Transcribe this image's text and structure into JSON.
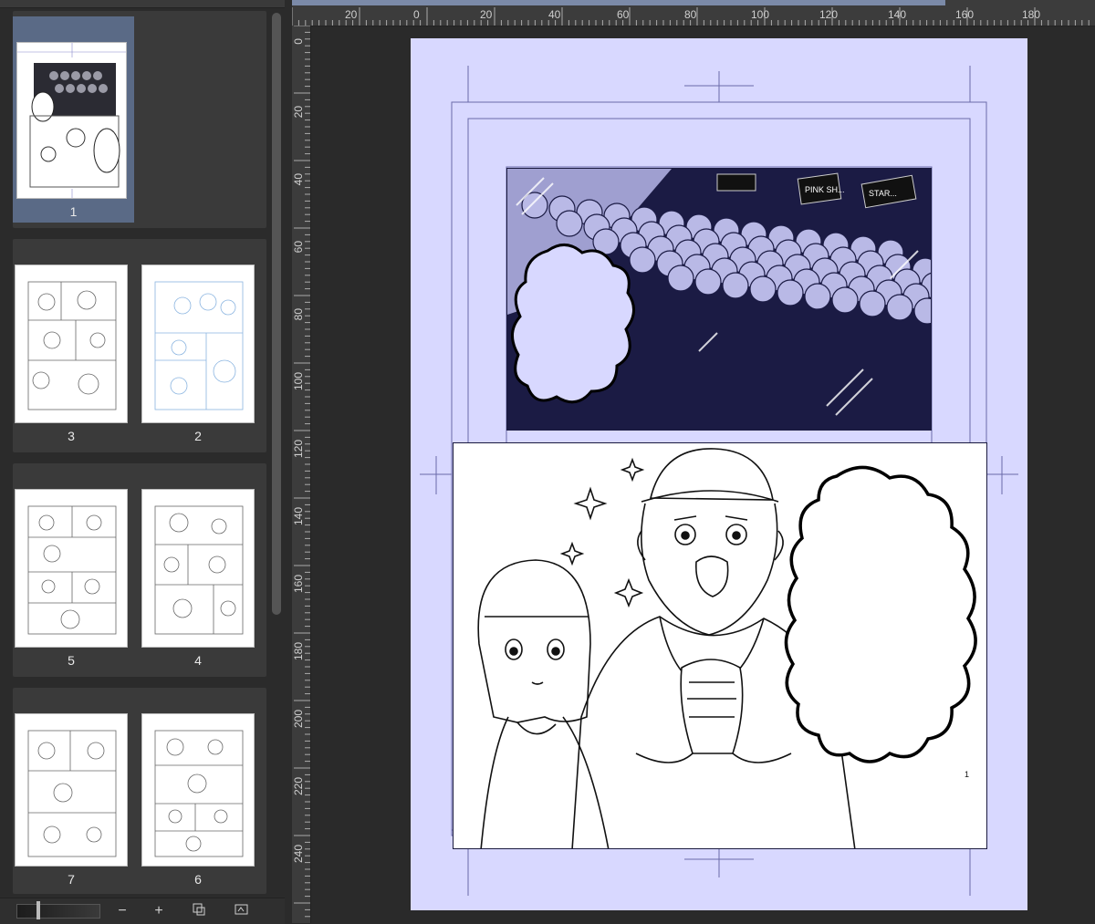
{
  "page_panel": {
    "pages": [
      {
        "number": "1",
        "selected": true
      },
      {
        "number": "3",
        "selected": false
      },
      {
        "number": "2",
        "selected": false
      },
      {
        "number": "5",
        "selected": false
      },
      {
        "number": "4",
        "selected": false
      },
      {
        "number": "7",
        "selected": false
      },
      {
        "number": "6",
        "selected": false
      }
    ],
    "toolbar": {
      "zoom_out": "−",
      "zoom_in": "+",
      "icons": [
        "page-settings-icon",
        "export-pages-icon"
      ]
    }
  },
  "ruler": {
    "top_ticks": [
      "20",
      "0",
      "20",
      "40",
      "60",
      "80",
      "100",
      "120",
      "140",
      "160",
      "180"
    ],
    "left_ticks": [
      "0",
      "20",
      "40",
      "60",
      "80",
      "100",
      "120",
      "140",
      "160",
      "180",
      "200",
      "220",
      "240"
    ]
  },
  "colors": {
    "page_tint": "#d8d8ff",
    "ink": "#1a1a3e",
    "guide": "#6a6aa8",
    "selected_page": "#5a6a86"
  },
  "canvas": {
    "panel_1_signs": [
      "PINK SH...",
      "STAR..."
    ],
    "panel_2_page_number": "1"
  }
}
